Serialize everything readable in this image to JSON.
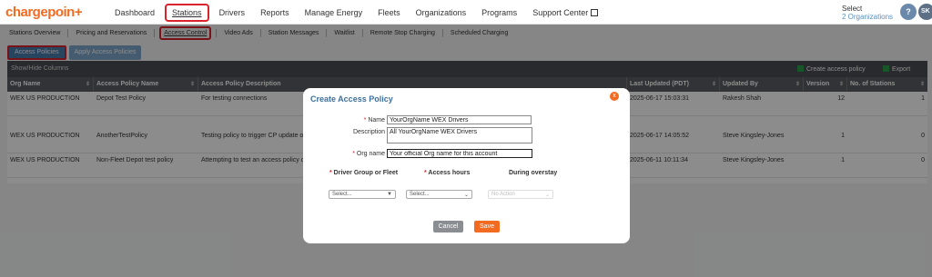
{
  "brand": {
    "name": "chargepoin",
    "suffix": "+"
  },
  "nav": {
    "items": [
      "Dashboard",
      "Stations",
      "Drivers",
      "Reports",
      "Manage Energy",
      "Fleets",
      "Organizations",
      "Programs",
      "Support Center"
    ],
    "active": "Stations"
  },
  "org": {
    "label": "Select",
    "value": "2 Organizations"
  },
  "user": {
    "help": "?",
    "initials": "SK"
  },
  "subnav": {
    "items": [
      "Stations Overview",
      "Pricing and Reservations",
      "Access Control",
      "Video Ads",
      "Station Messages",
      "Waitlist",
      "Remote Stop Charging",
      "Scheduled Charging"
    ],
    "active": "Access Control"
  },
  "tabs": {
    "access_policies": "Access Policies",
    "apply_access_policies": "Apply Access Policies"
  },
  "grid": {
    "show_hide": "Show/Hide Columns",
    "create": "Create access policy",
    "export": "Export",
    "columns": [
      "Org Name",
      "Access Policy Name",
      "Access Policy Description",
      "Last Updated (PDT)",
      "Updated By",
      "Version",
      "No. of Stations"
    ],
    "rows": [
      [
        "WEX US PRODUCTION",
        "Depot Test Policy",
        "For testing connections",
        "2025-06-17 15:03:31",
        "Rakesh Shah",
        "12",
        "1"
      ],
      [
        "WEX US PRODUCTION",
        "AnotherTestPolicy",
        "Testing policy to trigger CP update o",
        "2025-06-17 14:05:52",
        "Steve Kingsley-Jones",
        "1",
        "0"
      ],
      [
        "WEX US PRODUCTION",
        "Non-Fleet Depot test policy",
        "Attempting to test an access policy o",
        "2025-06-11 10:11:34",
        "Steve Kingsley-Jones",
        "1",
        "0"
      ]
    ]
  },
  "modal": {
    "title": "Create Access Policy",
    "close": "x",
    "name_label": "Name",
    "name_value": "YourOrgName WEX Drivers",
    "description_label": "Description",
    "description_value": "All YourOrgName WEX Drivers",
    "orgname_label": "Org name",
    "orgname_value": "Your official Org name for this account",
    "col_driver": "Driver Group or Fleet",
    "col_hours": "Access hours",
    "col_overstay": "During overstay",
    "select_placeholder": "Select...",
    "no_action": "No Action",
    "cancel": "Cancel",
    "save": "Save"
  },
  "colors": {
    "brand": "#f26b21",
    "active_outline": "#d9232d",
    "tab_blue": "#4a7eb0"
  }
}
